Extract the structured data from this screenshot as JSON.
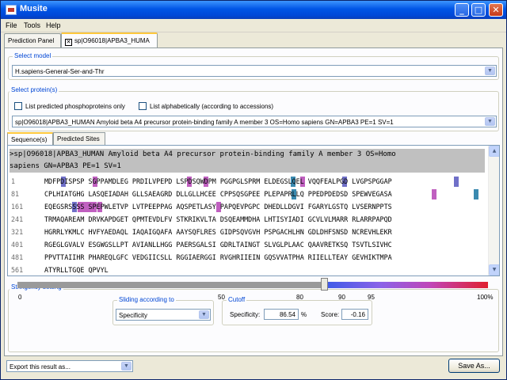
{
  "window": {
    "title": "Musite"
  },
  "menu": [
    "File",
    "Tools",
    "Help"
  ],
  "tabs": {
    "prediction_panel": "Prediction Panel",
    "protein_tab": "sp|O96018|APBA3_HUMA"
  },
  "select_model": {
    "legend": "Select model",
    "value": "H.sapiens-General-Ser-and-Thr"
  },
  "select_proteins": {
    "legend": "Select protein(s)",
    "chk_phospho": "List predicted phosphoproteins only",
    "chk_alpha": "List alphabetically (according to accessions)",
    "protein": "sp|O96018|APBA3_HUMAN Amyloid beta A4 precursor protein-binding family A member 3 OS=Homo sapiens GN=APBA3 PE=1 SV=1"
  },
  "subtabs": {
    "sequences": "Sequence(s)",
    "predicted_sites": "Predicted Sites"
  },
  "sequence": {
    "header_line1": ">sp|O96018|APBA3_HUMAN Amyloid beta A4 precursor protein-binding family A member 3 OS=Homo",
    "header_line2": "sapiens GN=APBA3 PE=1 SV=1",
    "rows": [
      {
        "num": "1",
        "text": "MDFPDISPSP SGPPAMDLEG PRDILVPEPD LSPDSQWDPM PGGPGLSPRM ELDEGSLQEL VQQFEALPGD LVGPSPGGAP"
      },
      {
        "num": "81",
        "text": "CPLHIATGHG LASQEIADAH GLLSAEAGRD DLLGLLHCEE CPPSQSGPEE PLEPAPRLLQ PPEDPDEDSD SPEWVEGASA"
      },
      {
        "num": "161",
        "text": "EQEGSRSSSS SPEPWLETVP LVTPEEPPAG AQSPETLASY PAPQEVPGPC DHEDLLDGVI FGARYLGSTQ LVSERNPPTS"
      },
      {
        "num": "241",
        "text": "TRMAQAREAM DRVKAPDGET QPMTEVDLFV STKRIKVLTA DSQEAMMDHA LHTISYIADI GCVLVLMARR RLARRPAPQD"
      },
      {
        "num": "321",
        "text": "HGRRLYKMLC HVFYAEDAQL IAQAIGQAFA AAYSQFLRES GIDPSQVGVH PSPGACHLHN GDLDHFSNSD NCREVHLEKR"
      },
      {
        "num": "401",
        "text": "RGEGLGVALV ESGWGSLLPT AVIANLLHGG PAERSGALSI GDRLTAINGT SLVGLPLAAC QAAVRETKSQ TSVTLSIVHC"
      },
      {
        "num": "481",
        "text": "PPVTTAIIHR PHAREQLGFC VEDGIICSLL RGGIAERGGI RVGHRIIEIN GQSVVATPHA RIIELLTEAY GEVHIKTMPA"
      },
      {
        "num": "561",
        "text": "ATYRLLTGQE QPVYL"
      }
    ]
  },
  "stringency": {
    "legend": "Stringency setting",
    "sliding_legend": "Sliding according to",
    "sliding_value": "Specificity",
    "cutoff_legend": "Cutoff",
    "specificity_label": "Specificity:",
    "specificity_value": "86.54",
    "percent": "%",
    "score_label": "Score:",
    "score_value": "-0.16",
    "slider_fraction": 0.8654,
    "ticks": [
      "0",
      "50",
      "80",
      "90",
      "95",
      "100%"
    ]
  },
  "footer": {
    "export_value": "Export this result as...",
    "save_button": "Save As..."
  },
  "colors": {
    "titlebar": "#0055e5",
    "legend": "#0046d5",
    "highlight_s": "#c060c0",
    "highlight_t": "#7070c8",
    "highlight_y": "#3a8ab0"
  },
  "icons": {
    "app": "musite-app-icon",
    "minimize": "minimize-icon",
    "maximize": "maximize-icon",
    "close": "close-icon",
    "combo": "chevron-down-icon"
  }
}
